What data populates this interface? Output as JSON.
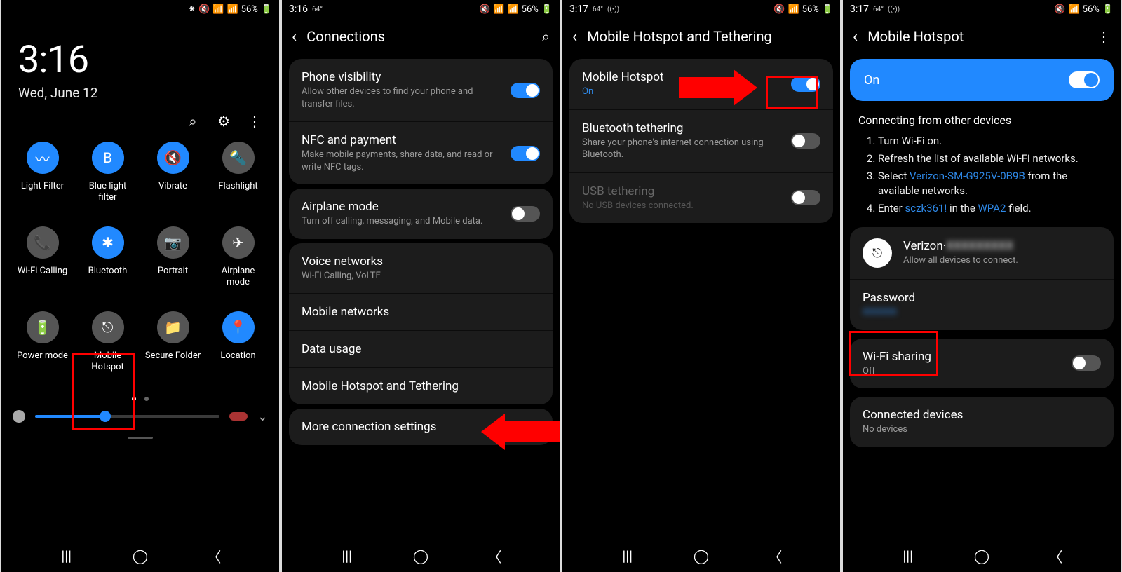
{
  "screen1": {
    "status": {
      "time": "",
      "icons": [
        "⁕",
        "🔇",
        "📶",
        "📶",
        "56%",
        "🔋"
      ]
    },
    "clock": "3:16",
    "date": "Wed, June 12",
    "actionIcons": {
      "search": "⌕",
      "settings": "⚙",
      "more": "⋮"
    },
    "tiles_row1": [
      {
        "icon": "〰",
        "label": "Light Filter",
        "on": true,
        "name": "wifi"
      },
      {
        "icon": "B",
        "label": "Blue light filter",
        "on": true,
        "name": "blue-light"
      },
      {
        "icon": "🔇",
        "label": "Vibrate",
        "on": true,
        "name": "vibrate"
      },
      {
        "icon": "🔦",
        "label": "Flashlight",
        "on": false,
        "name": "flashlight"
      }
    ],
    "tiles_row2": [
      {
        "icon": "📞",
        "label": "Wi-Fi Calling",
        "on": false,
        "name": "wifi-calling"
      },
      {
        "icon": "✱",
        "label": "Bluetooth",
        "on": true,
        "name": "bluetooth"
      },
      {
        "icon": "📷",
        "label": "Portrait",
        "on": false,
        "name": "portrait"
      },
      {
        "icon": "✈",
        "label": "Airplane mode",
        "on": false,
        "name": "airplane"
      }
    ],
    "tiles_row3": [
      {
        "icon": "🔋",
        "label": "Power mode",
        "on": false,
        "name": "power-mode"
      },
      {
        "icon": "⎋",
        "label": "Mobile Hotspot",
        "on": false,
        "name": "mobile-hotspot"
      },
      {
        "icon": "📁",
        "label": "Secure Folder",
        "on": false,
        "name": "secure-folder"
      },
      {
        "icon": "📍",
        "label": "Location",
        "on": true,
        "name": "location"
      }
    ]
  },
  "screen2": {
    "status": {
      "time": "3:16",
      "temp": "64°",
      "icons": [
        "🔇",
        "📶",
        "📶",
        "56%",
        "🔋"
      ]
    },
    "title": "Connections",
    "groups": [
      [
        {
          "title": "Phone visibility",
          "sub": "Allow other devices to find your phone and transfer files.",
          "toggle": "on"
        },
        {
          "title": "NFC and payment",
          "sub": "Make mobile payments, share data, and read or write NFC tags.",
          "toggle": "on"
        }
      ],
      [
        {
          "title": "Airplane mode",
          "sub": "Turn off calling, messaging, and Mobile data.",
          "toggle": "off"
        }
      ],
      [
        {
          "title": "Voice networks",
          "sub": "Wi-Fi Calling, VoLTE"
        },
        {
          "title": "Mobile networks"
        },
        {
          "title": "Data usage"
        },
        {
          "title": "Mobile Hotspot and Tethering"
        }
      ],
      [
        {
          "title": "More connection settings"
        }
      ]
    ]
  },
  "screen3": {
    "status": {
      "time": "3:17",
      "temp": "64°",
      "extra": "((•))",
      "icons": [
        "🔇",
        "📶",
        "56%",
        "🔋"
      ]
    },
    "title": "Mobile Hotspot and Tethering",
    "rows": [
      {
        "title": "Mobile Hotspot",
        "sub": "On",
        "subBlue": true,
        "toggle": "on"
      },
      {
        "title": "Bluetooth tethering",
        "sub": "Share your phone's internet connection using Bluetooth.",
        "toggle": "off"
      },
      {
        "title": "USB tethering",
        "sub": "No USB devices connected.",
        "toggle": "off",
        "disabled": true
      }
    ]
  },
  "screen4": {
    "status": {
      "time": "3:17",
      "temp": "64°",
      "extra": "((•))",
      "icons": [
        "🔇",
        "📶",
        "56%",
        "🔋"
      ]
    },
    "title": "Mobile Hotspot",
    "onLabel": "On",
    "instructHeading": "Connecting from other devices",
    "instructions": {
      "i1": "Turn Wi-Fi on.",
      "i2": "Refresh the list of available Wi-Fi networks.",
      "i3a": "Select ",
      "i3link": "Verizon-SM-G925V-0B9B",
      "i3b": " from the available networks.",
      "i4a": "Enter ",
      "i4pw": "sczk361!",
      "i4b": " in the ",
      "i4wpa": "WPA2",
      "i4c": " field."
    },
    "network": {
      "name": "Verizon·",
      "nameBlur": "XXXXXXXXX",
      "sub": "Allow all devices to connect."
    },
    "password": {
      "label": "Password",
      "valueBlur": "XXXXXX"
    },
    "wifiSharing": {
      "label": "Wi-Fi sharing",
      "sub": "Off"
    },
    "connected": {
      "label": "Connected devices",
      "sub": "No devices"
    }
  }
}
